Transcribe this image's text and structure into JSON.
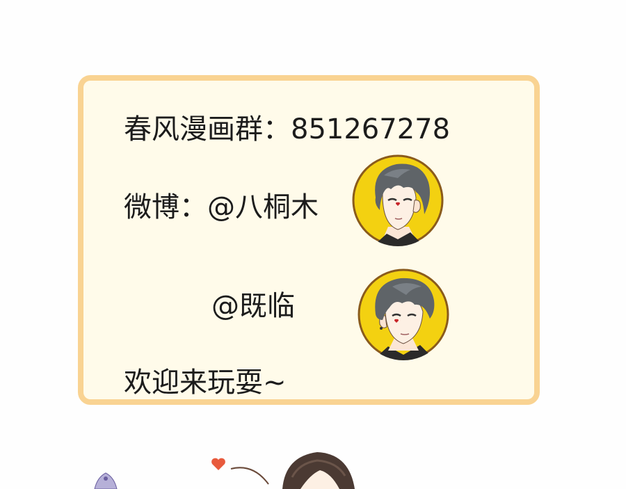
{
  "card": {
    "qq_group": "春风漫画群：851267278",
    "weibo_line": "微博：@八桐木",
    "second_handle": "@既临",
    "welcome": "欢迎来玩耍~"
  },
  "colors": {
    "card_background": "#fffbea",
    "card_border": "#f9d392",
    "avatar_background": "#f3d111",
    "avatar_ring": "#8a5b1c",
    "hair": "#5f6468",
    "text": "#1c1c1c"
  },
  "icons": {
    "avatar_1": "anime-boy-avatar-icon",
    "avatar_2": "anime-boy-avatar-icon",
    "heart": "heart-icon"
  }
}
